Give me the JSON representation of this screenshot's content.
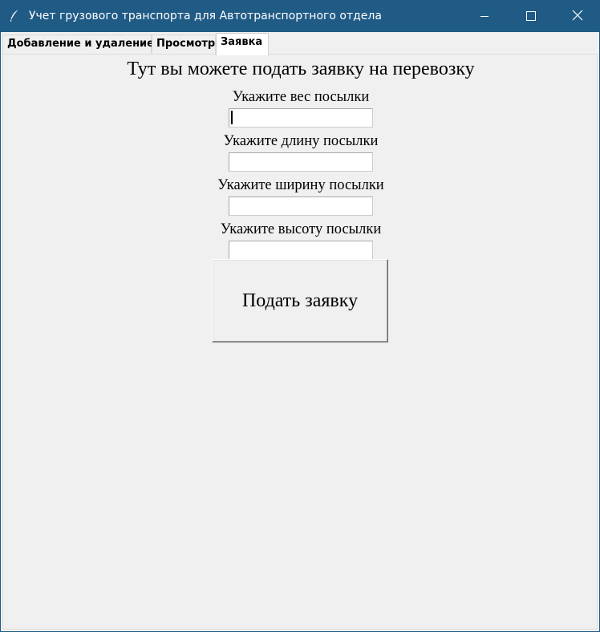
{
  "window": {
    "title": "Учет грузового транспорта для Автотранспортного отдела",
    "titlebar_color": "#205b86",
    "icon": "feather-icon",
    "controls": {
      "minimize_icon": "minimize-icon",
      "maximize_icon": "maximize-icon",
      "close_icon": "close-icon"
    }
  },
  "tabs": [
    {
      "label": "Добавление и удаление",
      "selected": false
    },
    {
      "label": "Просмотр",
      "selected": false
    },
    {
      "label": "Заявка",
      "selected": true
    }
  ],
  "form": {
    "heading": "Тут вы можете подать заявку на перевозку",
    "fields": [
      {
        "label": "Укажите вес посылки",
        "value": "",
        "placeholder": ""
      },
      {
        "label": "Укажите длину посылки",
        "value": "",
        "placeholder": ""
      },
      {
        "label": "Укажите ширину посылки",
        "value": "",
        "placeholder": ""
      },
      {
        "label": "Укажите высоту посылки",
        "value": "",
        "placeholder": ""
      }
    ],
    "submit_label": "Подать заявку"
  }
}
